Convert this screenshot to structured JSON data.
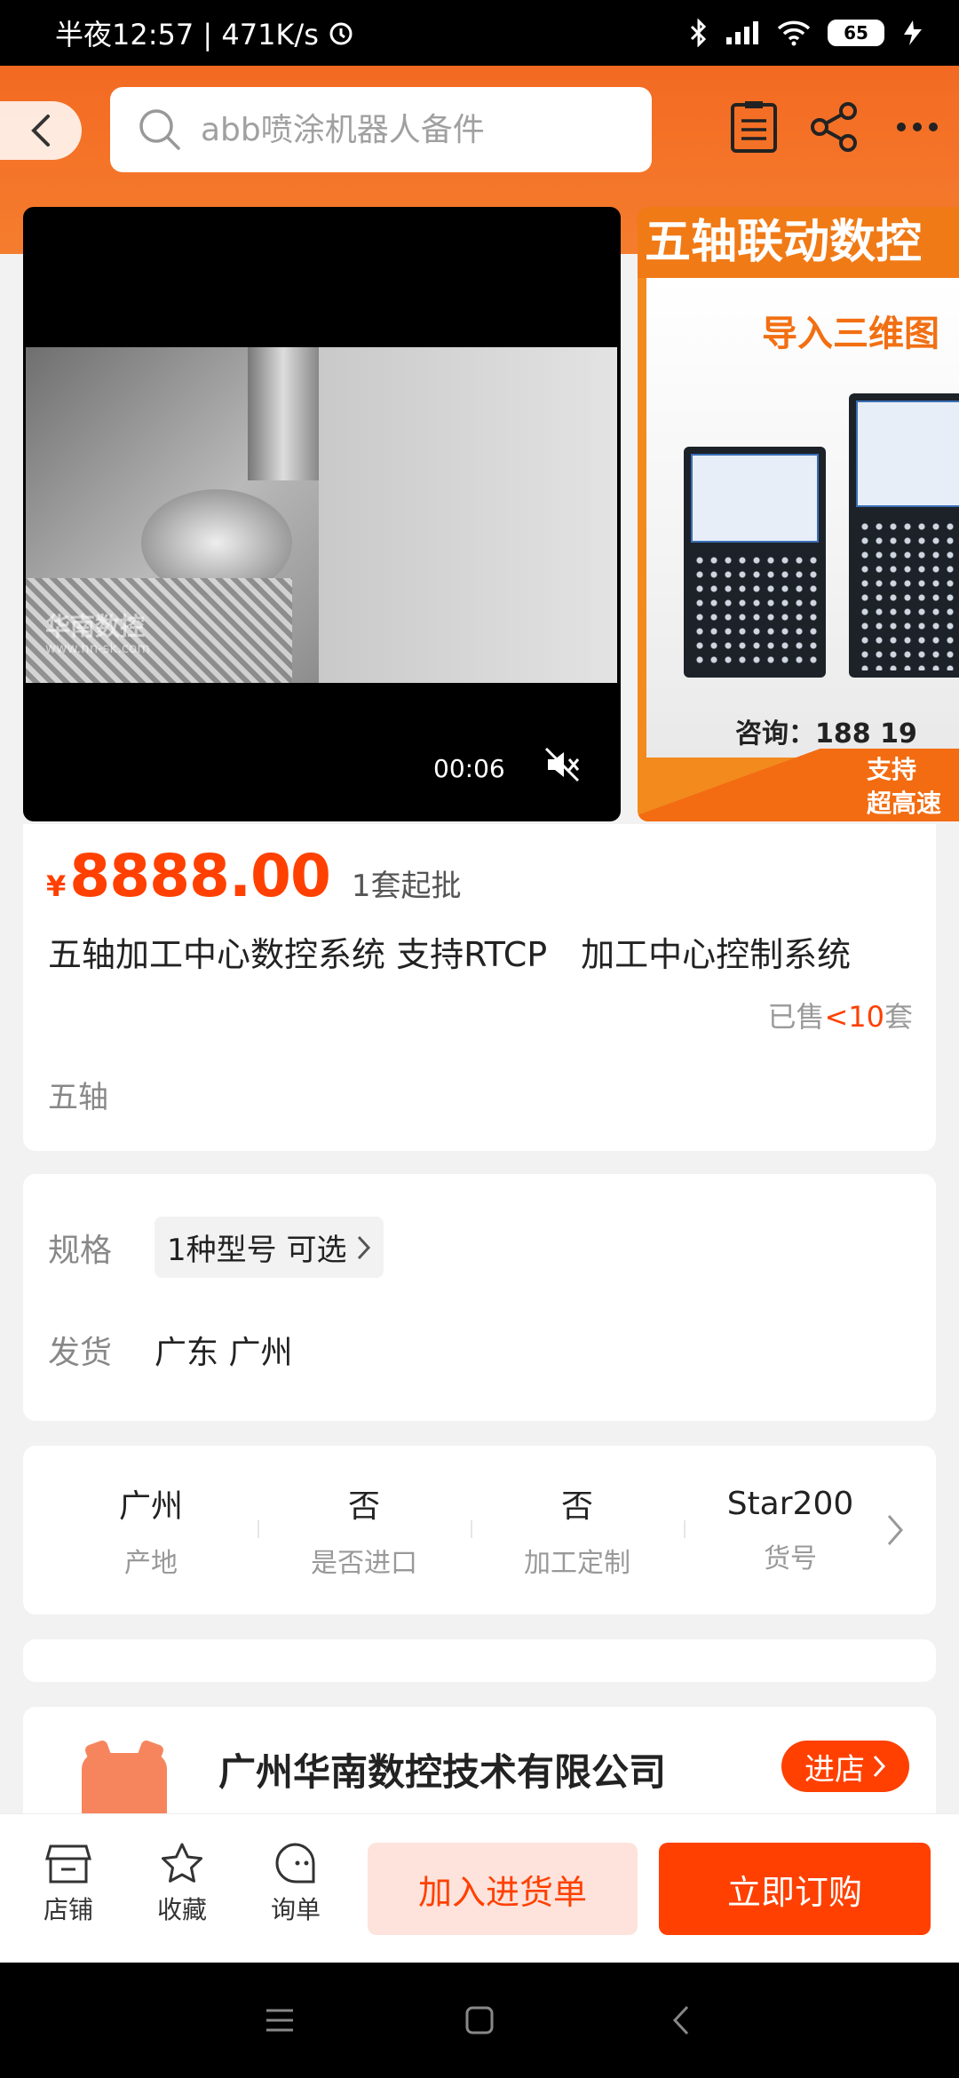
{
  "status_bar": {
    "time_speed": "半夜12:57 | 471K/s",
    "battery": "65"
  },
  "header": {
    "search_placeholder": "abb喷涂机器人备件"
  },
  "gallery": {
    "video_time": "00:06",
    "watermark_name": "华南数控",
    "watermark_url": "www.hn-sk.com",
    "promo_title": "五轴联动数控",
    "promo_subtitle": "导入三维图",
    "promo_contact": "咨询：188 19",
    "promo_foot_line1": "支持",
    "promo_foot_line2": "超高速"
  },
  "product": {
    "currency": "¥",
    "price": "8888.00",
    "moq": "1套起批",
    "title": "五轴加工中心数控系统 支持RTCP　加工中心控制系统",
    "sold_prefix": "已售",
    "sold_value": "<10",
    "sold_unit": "套",
    "tag": "五轴"
  },
  "specs": {
    "spec_label": "规格",
    "spec_value": "1种型号 可选",
    "ship_label": "发货",
    "ship_value": "广东 广州"
  },
  "attributes": [
    {
      "value": "广州",
      "key": "产地"
    },
    {
      "value": "否",
      "key": "是否进口"
    },
    {
      "value": "否",
      "key": "加工定制"
    },
    {
      "value": "Star200",
      "key": "货号"
    }
  ],
  "shop": {
    "name": "广州华南数控技术有限公司",
    "enter_label": "进店"
  },
  "bottom_bar": {
    "store_label": "店铺",
    "fav_label": "收藏",
    "inquiry_label": "询单",
    "add_label": "加入进货单",
    "buy_label": "立即订购"
  },
  "colors": {
    "accent": "#ff4000",
    "header": "#f36a22"
  }
}
